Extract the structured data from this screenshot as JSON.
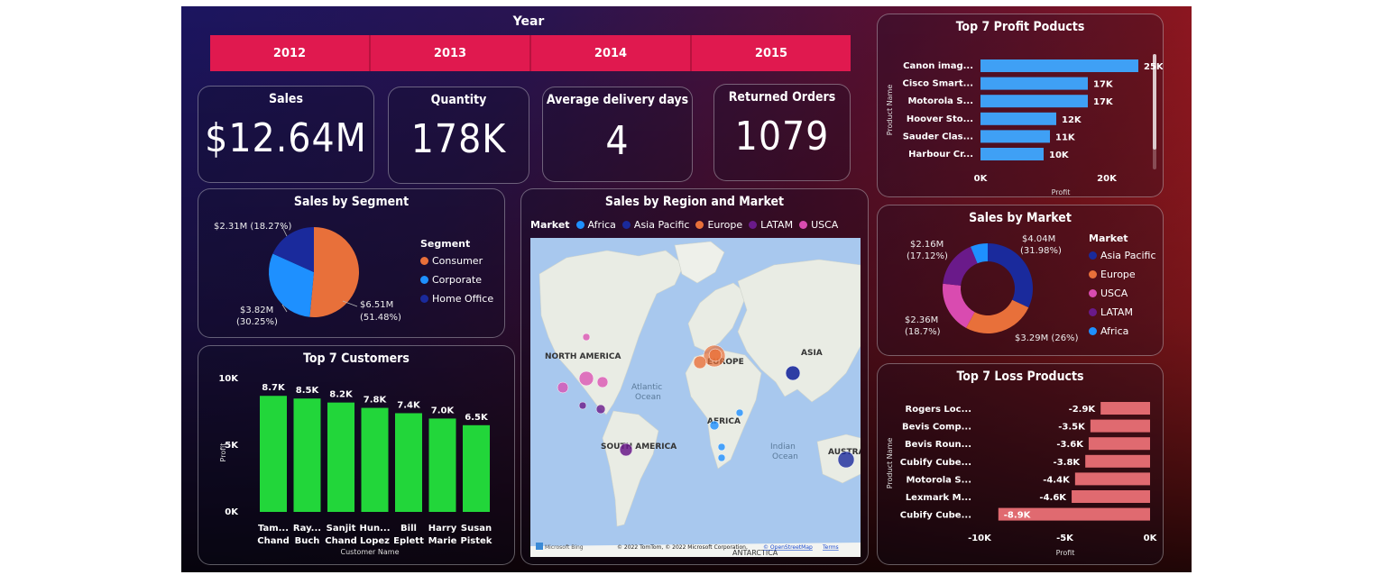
{
  "year_slicer": {
    "title": "Year",
    "years": [
      "2012",
      "2013",
      "2014",
      "2015"
    ]
  },
  "kpis": {
    "sales": {
      "label": "Sales",
      "value": "$12.64M"
    },
    "quantity": {
      "label": "Quantity",
      "value": "178K"
    },
    "avg_delivery": {
      "label": "Average delivery days",
      "value": "4"
    },
    "returned": {
      "label": "Returned Orders",
      "value": "1079"
    }
  },
  "colors": {
    "consumer": "#e8703a",
    "corporate": "#1e90ff",
    "home_office": "#1a2a9c",
    "asia_pacific": "#1a2a9c",
    "europe": "#e8703a",
    "usca": "#d94bb0",
    "latam": "#6a1a8a",
    "africa": "#1e90ff",
    "profit_bar": "#3fa0f5",
    "loss_bar": "#e06a70",
    "customer_bar": "#22d63a"
  },
  "segment_chart": {
    "title": "Sales by Segment",
    "legend_title": "Segment",
    "labels": {
      "home_office": "$2.31M (18.27%)",
      "corporate_line1": "$3.82M",
      "corporate_line2": "(30.25%)",
      "consumer_line1": "$6.51M",
      "consumer_line2": "(51.48%)"
    },
    "legend": [
      "Consumer",
      "Corporate",
      "Home Office"
    ]
  },
  "region_map": {
    "title": "Sales by Region and Market",
    "legend_title": "Market",
    "legend": [
      "Africa",
      "Asia Pacific",
      "Europe",
      "LATAM",
      "USCA"
    ],
    "place_labels": {
      "north_america": "NORTH AMERICA",
      "europe": "EUROPE",
      "asia": "ASIA",
      "africa": "AFRICA",
      "south_america": "SOUTH AMERICA",
      "australia": "AUSTRA",
      "atlantic1": "Atlantic",
      "atlantic2": "Ocean",
      "indian1": "Indian",
      "indian2": "Ocean",
      "antarctica": "ANTARCTICA"
    },
    "footer": {
      "bing": "Microsoft Bing",
      "credits": "© 2022 TomTom, © 2022 Microsoft Corporation,",
      "osm": "© OpenStreetMap",
      "terms": "Terms"
    }
  },
  "market_chart": {
    "title": "Sales by Market",
    "legend_title": "Market",
    "legend": [
      "Asia Pacific",
      "Europe",
      "USCA",
      "LATAM",
      "Africa"
    ],
    "labels": {
      "asia_line1": "$4.04M",
      "asia_line2": "(31.98%)",
      "europe": "$3.29M (26%)",
      "usca_line1": "$2.36M",
      "usca_line2": "(18.7%)",
      "latam_line1": "$2.16M",
      "latam_line2": "(17.12%)"
    }
  },
  "chart_data": [
    {
      "type": "bar",
      "orientation": "horizontal",
      "title": "Top 7 Profit Poducts",
      "ylabel": "Product Name",
      "xlabel": "Profit",
      "categories": [
        "Canon imag...",
        "Cisco Smart...",
        "Motorola S...",
        "Hoover Sto...",
        "Sauder Clas...",
        "Harbour Cr..."
      ],
      "values": [
        25000,
        17000,
        17000,
        12000,
        11000,
        10000
      ],
      "data_labels": [
        "25K",
        "17K",
        "17K",
        "12K",
        "11K",
        "10K"
      ],
      "xticks": [
        "0K",
        "20K"
      ],
      "xlim": [
        0,
        25000
      ]
    },
    {
      "type": "bar",
      "title": "Top 7 Customers",
      "ylabel": "Profit",
      "xlabel": "Customer Name",
      "categories": [
        [
          "Tam...",
          "Chand"
        ],
        [
          "Ray...",
          "Buch"
        ],
        [
          "Sanjit",
          "Chand"
        ],
        [
          "Hun...",
          "Lopez"
        ],
        [
          "Bill",
          "Eplett"
        ],
        [
          "Harry",
          "Marie"
        ],
        [
          "Susan",
          "Pistek"
        ]
      ],
      "values": [
        8700,
        8500,
        8200,
        7800,
        7400,
        7000,
        6500
      ],
      "data_labels": [
        "8.7K",
        "8.5K",
        "8.2K",
        "7.8K",
        "7.4K",
        "7.0K",
        "6.5K"
      ],
      "yticks": [
        "0K",
        "5K",
        "10K"
      ],
      "ylim": [
        0,
        10000
      ]
    },
    {
      "type": "bar",
      "orientation": "horizontal",
      "title": "Top 7 Loss Products",
      "ylabel": "Product Name",
      "xlabel": "Profit",
      "categories": [
        "Rogers Loc...",
        "Bevis Comp...",
        "Bevis Roun...",
        "Cubify Cube...",
        "Motorola S...",
        "Lexmark M...",
        "Cubify Cube..."
      ],
      "values": [
        -2900,
        -3500,
        -3600,
        -3800,
        -4400,
        -4600,
        -8900
      ],
      "data_labels": [
        "-2.9K",
        "-3.5K",
        "-3.6K",
        "-3.8K",
        "-4.4K",
        "-4.6K",
        "-8.9K"
      ],
      "xticks": [
        "-10K",
        "-5K",
        "0K"
      ],
      "xlim": [
        -10000,
        0
      ]
    },
    {
      "type": "pie",
      "title": "Sales by Segment",
      "categories": [
        "Consumer",
        "Corporate",
        "Home Office"
      ],
      "values": [
        51.48,
        30.25,
        18.27
      ],
      "amounts": [
        "$6.51M",
        "$3.82M",
        "$2.31M"
      ]
    },
    {
      "type": "pie",
      "title": "Sales by Market",
      "categories": [
        "Asia Pacific",
        "Europe",
        "USCA",
        "LATAM",
        "Africa"
      ],
      "values": [
        31.98,
        26.0,
        18.7,
        17.12,
        6.2
      ],
      "amounts": [
        "$4.04M",
        "$3.29M",
        "$2.36M",
        "$2.16M",
        ""
      ]
    }
  ]
}
